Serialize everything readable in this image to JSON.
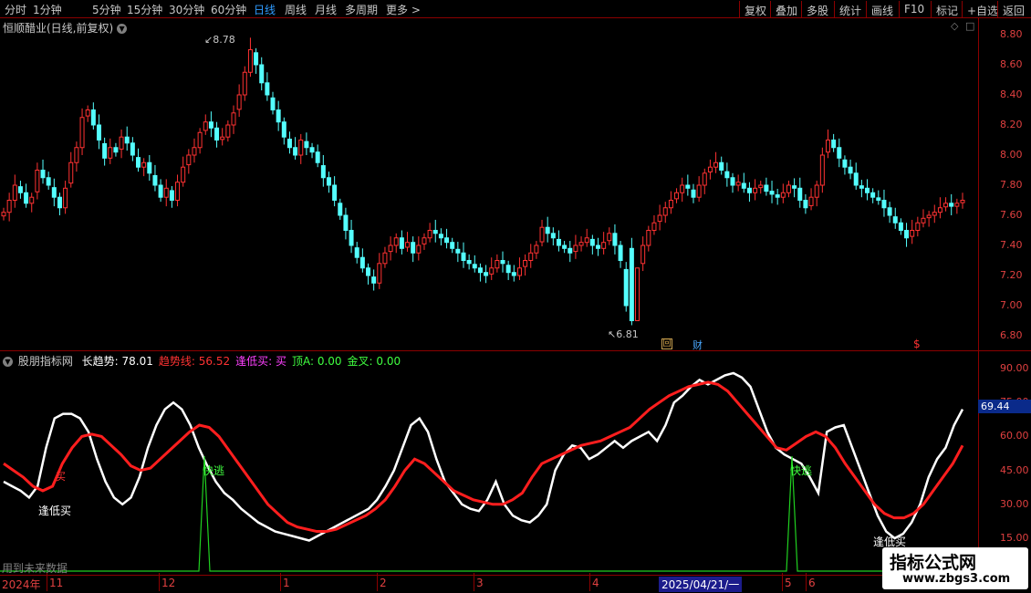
{
  "topbar": {
    "periods": [
      "分时",
      "1分钟",
      "5分钟",
      "15分钟",
      "30分钟",
      "60分钟",
      "日线",
      "周线",
      "月线",
      "多周期",
      "更多 >"
    ],
    "active_period": "日线",
    "right_buttons": [
      "复权",
      "叠加",
      "多股",
      "统计",
      "画线",
      "F10",
      "标记",
      "+自选",
      "返回"
    ]
  },
  "main_panel": {
    "title": "恒顺醋业(日线,前复权)",
    "high_label": "8.78",
    "low_label": "6.81",
    "y_ticks": [
      "8.80",
      "8.60",
      "8.40",
      "8.20",
      "8.00",
      "7.80",
      "7.60",
      "7.40",
      "7.20",
      "7.00",
      "6.80"
    ],
    "markers": {
      "hui": "回",
      "cai": "财",
      "dollar": "$"
    },
    "colors": {
      "up": "#ff3232",
      "down": "#54ffff"
    }
  },
  "indicator_panel": {
    "title": "股朋指标网",
    "legend": [
      {
        "label": "长趋势:",
        "value": "78.01",
        "color": "#ffffff"
      },
      {
        "label": "趋势线:",
        "value": "56.52",
        "color": "#ff3232"
      },
      {
        "label": "逢低买:",
        "value": "买",
        "color": "#ff40ff"
      },
      {
        "label": "顶A:",
        "value": "0.00",
        "color": "#40ff40"
      },
      {
        "label": "金叉:",
        "value": "0.00",
        "color": "#40ff40"
      }
    ],
    "y_ticks": [
      "90.00",
      "75.00",
      "60.00",
      "45.00",
      "30.00",
      "15.00"
    ],
    "current_value": "69.44",
    "annotations": {
      "buy_low": "逢低买",
      "quick_escape": "快逃",
      "buy": "买"
    },
    "note": "用到未来数据"
  },
  "xaxis": {
    "labels": [
      "2024年",
      "11",
      "12",
      "1",
      "2",
      "3",
      "4",
      "2025/04/21/一",
      "5",
      "6"
    ]
  },
  "watermark": {
    "line1": "指标公式网",
    "line2": "www.zbgs3.com"
  },
  "chart_data": {
    "type": "candlestick",
    "title": "恒顺醋业(日线,前复权)",
    "ylim": [
      6.75,
      8.85
    ],
    "high": 8.78,
    "low": 6.81,
    "close_series": [
      7.62,
      7.7,
      7.8,
      7.75,
      7.68,
      7.72,
      7.9,
      7.85,
      7.8,
      7.72,
      7.65,
      7.78,
      7.95,
      8.05,
      8.25,
      8.3,
      8.2,
      8.1,
      7.98,
      8.05,
      8.02,
      8.12,
      8.08,
      8.0,
      7.92,
      7.95,
      7.88,
      7.8,
      7.72,
      7.78,
      7.7,
      7.82,
      7.92,
      8.0,
      8.05,
      8.15,
      8.22,
      8.18,
      8.1,
      8.12,
      8.2,
      8.28,
      8.4,
      8.55,
      8.7,
      8.6,
      8.48,
      8.4,
      8.3,
      8.22,
      8.12,
      8.05,
      8.0,
      8.1,
      8.05,
      8.02,
      7.95,
      7.85,
      7.8,
      7.7,
      7.6,
      7.5,
      7.4,
      7.32,
      7.25,
      7.2,
      7.15,
      7.28,
      7.35,
      7.4,
      7.45,
      7.38,
      7.42,
      7.35,
      7.4,
      7.45,
      7.5,
      7.48,
      7.45,
      7.42,
      7.38,
      7.35,
      7.3,
      7.28,
      7.25,
      7.22,
      7.2,
      7.25,
      7.3,
      7.28,
      7.22,
      7.2,
      7.25,
      7.3,
      7.35,
      7.4,
      7.52,
      7.48,
      7.45,
      7.4,
      7.38,
      7.35,
      7.4,
      7.42,
      7.45,
      7.4,
      7.38,
      7.42,
      7.48,
      7.4,
      7.3,
      7.0,
      6.9,
      7.25,
      7.4,
      7.5,
      7.55,
      7.6,
      7.65,
      7.7,
      7.75,
      7.8,
      7.78,
      7.72,
      7.8,
      7.88,
      7.92,
      7.95,
      7.9,
      7.85,
      7.8,
      7.82,
      7.78,
      7.75,
      7.78,
      7.8,
      7.76,
      7.74,
      7.72,
      7.75,
      7.8,
      7.78,
      7.7,
      7.65,
      7.72,
      7.8,
      8.0,
      8.1,
      8.05,
      7.98,
      7.92,
      7.88,
      7.8,
      7.78,
      7.75,
      7.72,
      7.7,
      7.65,
      7.6,
      7.55,
      7.5,
      7.45,
      7.5,
      7.55,
      7.58,
      7.6,
      7.62,
      7.65,
      7.68,
      7.66,
      7.68,
      7.7
    ]
  }
}
